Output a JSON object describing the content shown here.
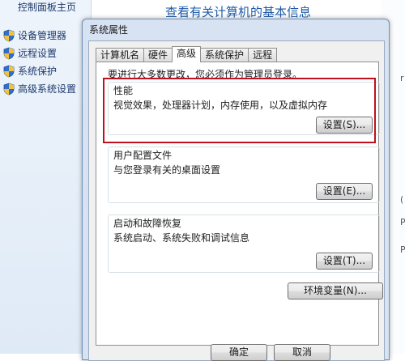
{
  "control_panel": {
    "home": "控制面板主页",
    "links": [
      "设备管理器",
      "远程设置",
      "系统保护",
      "高级系统设置"
    ],
    "main_title": "查看有关计算机的基本信息",
    "edge_glyphs": [
      "r",
      "(",
      "P",
      "P"
    ]
  },
  "dialog": {
    "title": "系统属性",
    "tabs": [
      "计算机名",
      "硬件",
      "高级",
      "系统保护",
      "远程"
    ],
    "active_tab": "高级",
    "notice": "要进行大多数更改，您必须作为管理员登录。",
    "performance": {
      "title": "性能",
      "desc": "视觉效果，处理器计划，内存使用，以及虚拟内存",
      "button": "设置(S)..."
    },
    "user_profiles": {
      "title": "用户配置文件",
      "desc": "与您登录有关的桌面设置",
      "button": "设置(E)..."
    },
    "startup_recovery": {
      "title": "启动和故障恢复",
      "desc": "系统启动、系统失败和调试信息",
      "button": "设置(T)..."
    },
    "env_button": "环境变量(N)...",
    "ok_button": "确定",
    "cancel_button": "取消"
  },
  "colors": {
    "highlight_border": "#c01020",
    "link_text": "#1e3a6e",
    "title_text": "#1e5aa8"
  }
}
